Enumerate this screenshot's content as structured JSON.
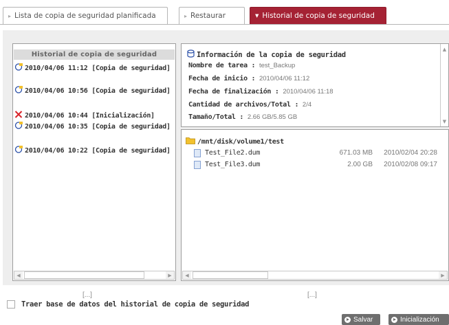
{
  "tabs": [
    {
      "label": "Lista de copia de seguridad planificada"
    },
    {
      "label": "Restaurar"
    },
    {
      "label": "Historial de copia de seguridad"
    }
  ],
  "history": {
    "header": "Historial de copia de seguridad",
    "items": [
      {
        "text": "2010/04/06 11:12 [Copia de seguridad]",
        "icon": "backup-icon"
      },
      {
        "text": "2010/04/06 10:56 [Copia de seguridad]",
        "icon": "backup-icon"
      },
      {
        "text": "2010/04/06 10:44 [Inicialización]",
        "icon": "error-x-icon"
      },
      {
        "text": "2010/04/06 10:35 [Copia de seguridad]",
        "icon": "backup-icon"
      },
      {
        "text": "2010/04/06 10:22 [Copia de seguridad]",
        "icon": "backup-icon"
      }
    ],
    "ellipsis": "[...]"
  },
  "info": {
    "title": "Información de la copia de seguridad",
    "rows": [
      {
        "label": "Nombre de tarea :",
        "value": "test_Backup"
      },
      {
        "label": "Fecha de inicio :",
        "value": "2010/04/06 11:12"
      },
      {
        "label": "Fecha de finalización :",
        "value": "2010/04/06 11:18"
      },
      {
        "label": "Cantidad de archivos/Total :",
        "value": "2/4"
      },
      {
        "label": "Tamaño/Total :",
        "value": "2.66 GB/5.85 GB"
      }
    ]
  },
  "files": {
    "folder": "/mnt/disk/volume1/test",
    "items": [
      {
        "name": "Test_File2.dum",
        "size": "671.03 MB",
        "date": "2010/02/04 20:28"
      },
      {
        "name": "Test_File3.dum",
        "size": "2.00 GB",
        "date": "2010/02/08 09:17"
      }
    ],
    "ellipsis": "[...]"
  },
  "checkbox": {
    "label": "Traer base de datos del historial de copia de seguridad",
    "checked": false
  },
  "buttons": {
    "save": "Salvar",
    "init": "Inicialización"
  },
  "colors": {
    "active_tab": "#a52234",
    "button": "#6e6e6e",
    "error": "#d9242b",
    "icon_blue": "#2a4fa8",
    "folder": "#f2c12e"
  }
}
